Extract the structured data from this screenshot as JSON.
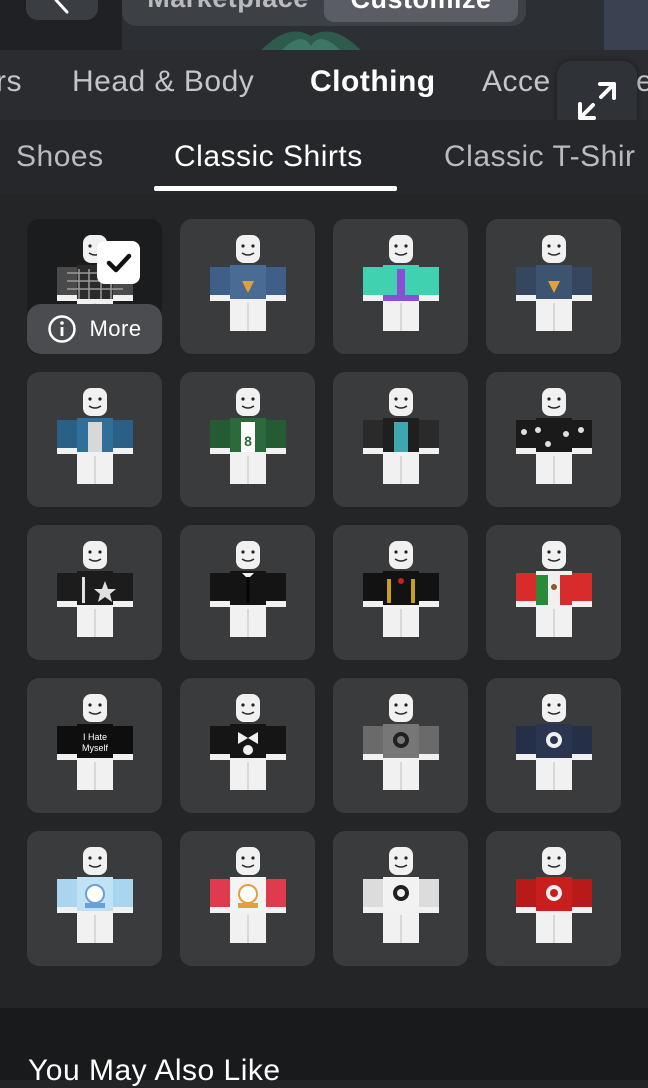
{
  "header": {
    "marketplace_label": "Marketplace",
    "customize_label": "Customize"
  },
  "category_tabs": [
    {
      "label": "rs",
      "active": false
    },
    {
      "label": "Head & Body",
      "active": false
    },
    {
      "label": "Clothing",
      "active": true
    },
    {
      "label": "Acce",
      "active": false
    },
    {
      "label": "e",
      "active": false
    }
  ],
  "sub_tabs": [
    {
      "label": "Shoes",
      "active": false
    },
    {
      "label": "Classic Shirts",
      "active": true
    },
    {
      "label": "Classic T-Shir",
      "active": false
    }
  ],
  "selected_item": {
    "more_label": "More",
    "icon": "info-icon"
  },
  "items": [
    {
      "shirt": "#2b2b2b",
      "sleeve": "#4a4a4a",
      "detail": "#9a9a9a",
      "motif": "plaid",
      "text": ""
    },
    {
      "shirt": "#4a6b94",
      "sleeve": "#3f5f88",
      "detail": "#e0a040",
      "motif": "pizza",
      "text": ""
    },
    {
      "shirt": "#3fd1b0",
      "sleeve": "#3fd1b0",
      "detail": "#8a4fd6",
      "motif": "stripe",
      "text": ""
    },
    {
      "shirt": "#3c5470",
      "sleeve": "#34475f",
      "detail": "#e0a040",
      "motif": "pizza",
      "text": ""
    },
    {
      "shirt": "#2f6f9a",
      "sleeve": "#2a5f86",
      "detail": "#d8d8d8",
      "motif": "jacket",
      "text": ""
    },
    {
      "shirt": "#2c6a3c",
      "sleeve": "#245b33",
      "detail": "#e8e8e8",
      "motif": "number",
      "text": "8"
    },
    {
      "shirt": "#1f1f1f",
      "sleeve": "#2a2a2a",
      "detail": "#3fa6b0",
      "motif": "jacket",
      "text": ""
    },
    {
      "shirt": "#1a1a1a",
      "sleeve": "#1a1a1a",
      "detail": "#e0e0e0",
      "motif": "stars",
      "text": ""
    },
    {
      "shirt": "#1c1c1c",
      "sleeve": "#1c1c1c",
      "detail": "#e0e0e0",
      "motif": "star",
      "text": ""
    },
    {
      "shirt": "#141414",
      "sleeve": "#141414",
      "detail": "#f0f0f0",
      "motif": "tie",
      "text": ""
    },
    {
      "shirt": "#121212",
      "sleeve": "#121212",
      "detail": "#c8a020",
      "motif": "gold",
      "text": ""
    },
    {
      "shirt": "#f0f0f0",
      "sleeve": "#d82c2c",
      "detail": "#2a8a3a",
      "motif": "flag",
      "text": ""
    },
    {
      "shirt": "#0e0e0e",
      "sleeve": "#0e0e0e",
      "detail": "#ffffff",
      "motif": "text",
      "text": "I Hate Myself"
    },
    {
      "shirt": "#151515",
      "sleeve": "#151515",
      "detail": "#f0f0f0",
      "motif": "bows",
      "text": ""
    },
    {
      "shirt": "#777777",
      "sleeve": "#6a6a6a",
      "detail": "#202020",
      "motif": "face",
      "text": ""
    },
    {
      "shirt": "#2a3550",
      "sleeve": "#252f48",
      "detail": "#f0f0f0",
      "motif": "face",
      "text": ""
    },
    {
      "shirt": "#bfe3f5",
      "sleeve": "#a9d6ee",
      "detail": "#6aa0d8",
      "motif": "cute",
      "text": ""
    },
    {
      "shirt": "#f4f4f4",
      "sleeve": "#e03a4e",
      "detail": "#e0a040",
      "motif": "cute",
      "text": ""
    },
    {
      "shirt": "#f2f2f2",
      "sleeve": "#dcdcdc",
      "detail": "#202020",
      "motif": "face",
      "text": ""
    },
    {
      "shirt": "#c81e1e",
      "sleeve": "#b81a1a",
      "detail": "#f0f0f0",
      "motif": "face",
      "text": ""
    }
  ],
  "recommendations": {
    "title": "You May Also Like"
  }
}
